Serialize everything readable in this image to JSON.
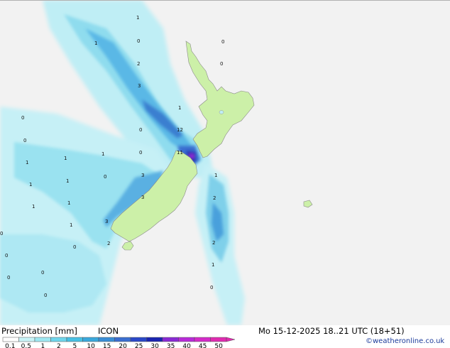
{
  "title": {
    "left": "Precipitation [mm]",
    "model": "ICON",
    "datetime": "Mo 15-12-2025 18..21 UTC (18+51)",
    "credit": "©weatheronline.co.uk"
  },
  "legend": {
    "ticks": [
      "0.1",
      "0.5",
      "1",
      "2",
      "5",
      "10",
      "15",
      "20",
      "25",
      "30",
      "35",
      "40",
      "45",
      "50"
    ],
    "colors": [
      "#ffffff",
      "#c8f4f8",
      "#9ee8f2",
      "#6fd6ec",
      "#48c0e4",
      "#3aa8dc",
      "#3a8ed6",
      "#3a6ed0",
      "#2a48c8",
      "#1a24b0",
      "#8a2ad4",
      "#b82ad8",
      "#d42ac8",
      "#e02ab0"
    ]
  },
  "land_color": "#ccf0a8",
  "map_values": [
    "1",
    "1",
    "0",
    "0",
    "2",
    "3",
    "1",
    "0",
    "12",
    "11",
    "0",
    "0",
    "1",
    "1",
    "3",
    "3",
    "0",
    "2",
    "3",
    "2",
    "1",
    "1",
    "1",
    "1",
    "0",
    "1",
    "1",
    "0",
    "0",
    "1",
    "2",
    "0",
    "0",
    "1",
    "0",
    "0",
    "0",
    "0"
  ]
}
